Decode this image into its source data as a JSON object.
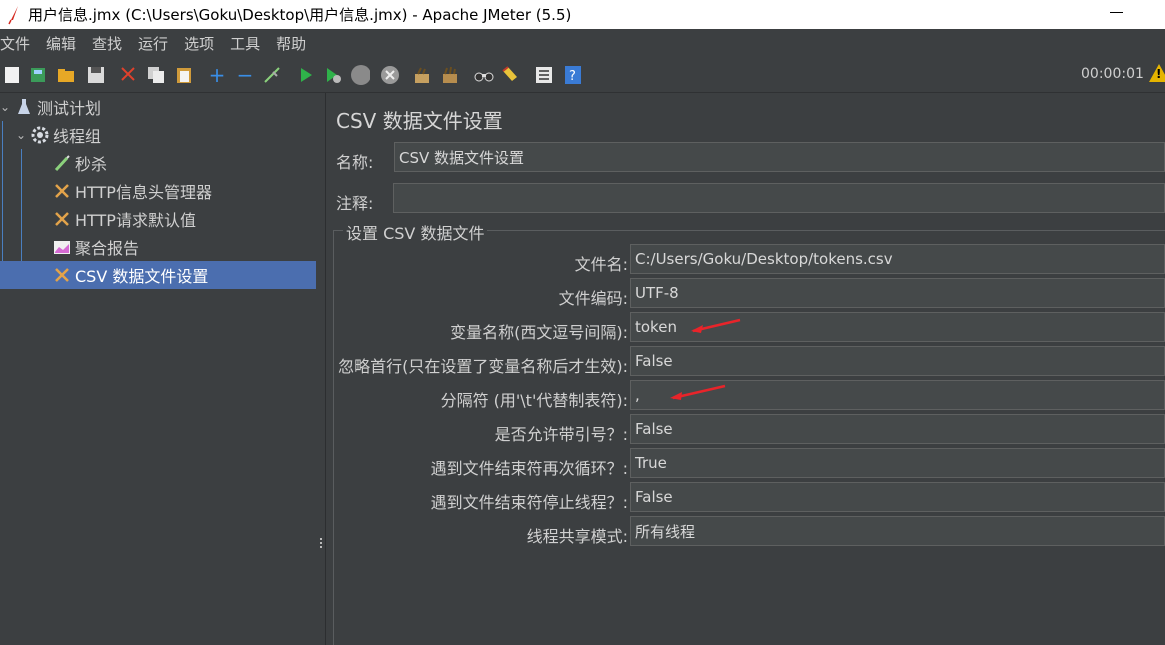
{
  "window": {
    "title": "用户信息.jmx (C:\\Users\\Goku\\Desktop\\用户信息.jmx) - Apache JMeter (5.5)"
  },
  "menu": [
    "文件",
    "编辑",
    "查找",
    "运行",
    "选项",
    "工具",
    "帮助"
  ],
  "toolbar": {
    "timer": "00:00:01",
    "icons": [
      "new-icon",
      "templates-icon",
      "open-icon",
      "save-icon",
      "cut-icon",
      "copy-icon",
      "paste-icon",
      "expand-icon",
      "collapse-icon",
      "toggle-icon",
      "start-icon",
      "start-no-pause-icon",
      "stop-icon",
      "shutdown-icon",
      "clear-icon",
      "clear-all-icon",
      "search-icon",
      "reset-search-icon",
      "function-helper-icon",
      "help-icon",
      "warning-icon"
    ]
  },
  "tree": {
    "items": [
      {
        "label": "测试计划",
        "icon": "flask-icon"
      },
      {
        "label": "线程组",
        "icon": "gear-icon"
      },
      {
        "label": "秒杀",
        "icon": "pipette-icon"
      },
      {
        "label": "HTTP信息头管理器",
        "icon": "tools-icon"
      },
      {
        "label": "HTTP请求默认值",
        "icon": "tools-icon"
      },
      {
        "label": "聚合报告",
        "icon": "graph-icon"
      },
      {
        "label": "CSV 数据文件设置",
        "icon": "tools-icon"
      }
    ]
  },
  "panel": {
    "title": "CSV 数据文件设置",
    "name_label": "名称:",
    "name_value": "CSV 数据文件设置",
    "comment_label": "注释:",
    "comment_value": "",
    "group_title": "设置 CSV 数据文件",
    "fields": [
      {
        "label": "文件名:",
        "value": "C:/Users/Goku/Desktop/tokens.csv"
      },
      {
        "label": "文件编码:",
        "value": "UTF-8"
      },
      {
        "label": "变量名称(西文逗号间隔):",
        "value": "token"
      },
      {
        "label": "忽略首行(只在设置了变量名称后才生效):",
        "value": "False"
      },
      {
        "label": "分隔符 (用'\\t'代替制表符):",
        "value": ","
      },
      {
        "label": "是否允许带引号？:",
        "value": "False"
      },
      {
        "label": "遇到文件结束符再次循环？:",
        "value": "True"
      },
      {
        "label": "遇到文件结束符停止线程？:",
        "value": "False"
      },
      {
        "label": "线程共享模式:",
        "value": "所有线程"
      }
    ]
  },
  "colors": {
    "background": "#3c3f41",
    "selection": "#4b6eaf",
    "field_bg": "#45494a",
    "annotation_arrow": "#e8242a"
  }
}
